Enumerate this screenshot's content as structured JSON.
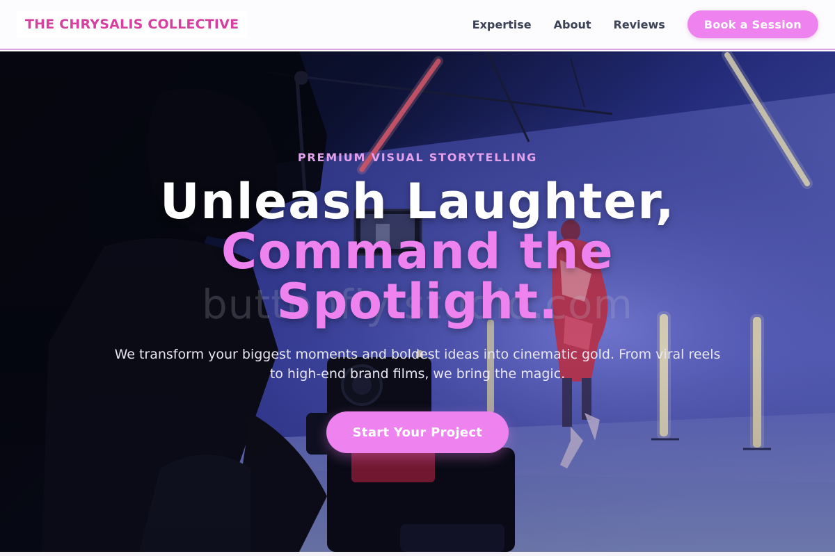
{
  "header": {
    "brand": "THE CHRYSALIS COLLECTIVE",
    "nav": [
      {
        "label": "Expertise"
      },
      {
        "label": "About"
      },
      {
        "label": "Reviews"
      }
    ],
    "cta_label": "Book a Session"
  },
  "hero": {
    "eyebrow": "PREMIUM VISUAL STORYTELLING",
    "headline_line1": "Unleash Laughter,",
    "headline_line2": "Command the",
    "headline_line3": "Spotlight.",
    "subtitle": "We transform your biggest moments and boldest ideas into cinematic gold. From viral reels to high-end brand films, we bring the magic.",
    "cta_label": "Start Your Project",
    "watermark": "buttonfly studio.com"
  },
  "colors": {
    "brand": "#d6409f",
    "accent": "#ee82ee",
    "nav_text": "#3b4256",
    "eyebrow": "#e3a1ec",
    "header_border": "#d9a3e6"
  },
  "icons": {
    "background_photo": "film-set-photo"
  }
}
